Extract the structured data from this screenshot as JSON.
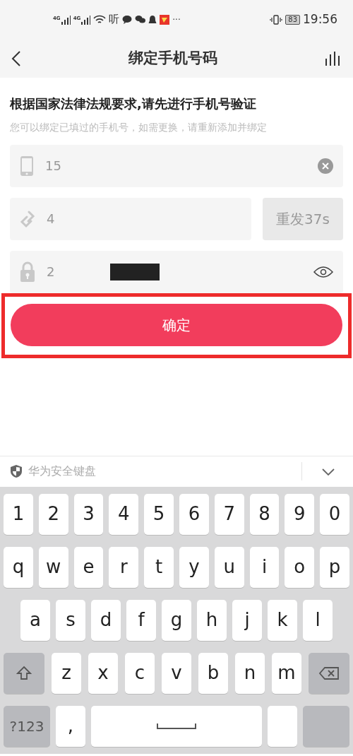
{
  "status_bar": {
    "network_labels": [
      "4G",
      "4G"
    ],
    "app_glyph": "听",
    "more": "···",
    "battery": "83",
    "time": "19:56"
  },
  "header": {
    "title": "绑定手机号码"
  },
  "notice": {
    "title": "根据国家法律法规要求,请先进行手机号验证",
    "subtitle": "您可以绑定已填过的手机号，如需更换，请重新添加并绑定"
  },
  "fields": [
    {
      "kind": "phone",
      "value": "15"
    },
    {
      "kind": "code",
      "value": "4",
      "resend": "重发37s"
    },
    {
      "kind": "password",
      "value": "2",
      "redacted": true
    }
  ],
  "confirm_button": {
    "label": "确定",
    "highlighted": true
  },
  "keyboard": {
    "title": "华为安全键盘",
    "rows": [
      [
        {
          "kind": "char",
          "label": "1"
        },
        {
          "kind": "char",
          "label": "2"
        },
        {
          "kind": "char",
          "label": "3"
        },
        {
          "kind": "char",
          "label": "4"
        },
        {
          "kind": "char",
          "label": "5"
        },
        {
          "kind": "char",
          "label": "6"
        },
        {
          "kind": "char",
          "label": "7"
        },
        {
          "kind": "char",
          "label": "8"
        },
        {
          "kind": "char",
          "label": "9"
        },
        {
          "kind": "char",
          "label": "0"
        }
      ],
      [
        {
          "kind": "char",
          "label": "q"
        },
        {
          "kind": "char",
          "label": "w"
        },
        {
          "kind": "char",
          "label": "e"
        },
        {
          "kind": "char",
          "label": "r"
        },
        {
          "kind": "char",
          "label": "t"
        },
        {
          "kind": "char",
          "label": "y"
        },
        {
          "kind": "char",
          "label": "u"
        },
        {
          "kind": "char",
          "label": "i"
        },
        {
          "kind": "char",
          "label": "o"
        },
        {
          "kind": "char",
          "label": "p"
        }
      ],
      [
        {
          "kind": "char",
          "label": "a"
        },
        {
          "kind": "char",
          "label": "s"
        },
        {
          "kind": "char",
          "label": "d"
        },
        {
          "kind": "char",
          "label": "f"
        },
        {
          "kind": "char",
          "label": "g"
        },
        {
          "kind": "char",
          "label": "h"
        },
        {
          "kind": "char",
          "label": "j"
        },
        {
          "kind": "char",
          "label": "k"
        },
        {
          "kind": "char",
          "label": "l"
        }
      ],
      [
        {
          "kind": "shift"
        },
        {
          "kind": "char",
          "label": "z"
        },
        {
          "kind": "char",
          "label": "x"
        },
        {
          "kind": "char",
          "label": "c"
        },
        {
          "kind": "char",
          "label": "v"
        },
        {
          "kind": "char",
          "label": "b"
        },
        {
          "kind": "char",
          "label": "n"
        },
        {
          "kind": "char",
          "label": "m"
        },
        {
          "kind": "backspace"
        }
      ],
      [
        {
          "kind": "symbols",
          "label": "?123"
        },
        {
          "kind": "char",
          "label": ","
        },
        {
          "kind": "space"
        },
        {
          "kind": "blank"
        },
        {
          "kind": "enter"
        }
      ]
    ]
  }
}
